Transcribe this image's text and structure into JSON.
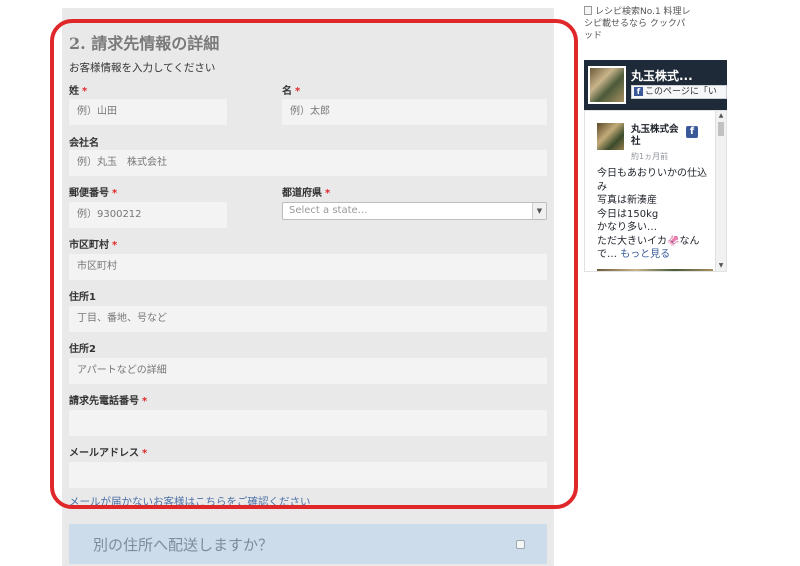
{
  "section": {
    "title": "2. 請求先情報の詳細",
    "intro": "お客様情報を入力してください"
  },
  "fields": {
    "last_name": {
      "label": "姓",
      "placeholder": "例）山田"
    },
    "first_name": {
      "label": "名",
      "placeholder": "例）太郎"
    },
    "company": {
      "label": "会社名",
      "placeholder": "例）丸玉　株式会社"
    },
    "postcode": {
      "label": "郵便番号",
      "placeholder": "例）9300212"
    },
    "state": {
      "label": "都道府県",
      "placeholder": "Select a state…"
    },
    "city": {
      "label": "市区町村",
      "placeholder": "市区町村"
    },
    "address1": {
      "label": "住所1",
      "placeholder": "丁目、番地、号など"
    },
    "address2": {
      "label": "住所2",
      "placeholder": "アパートなどの詳細"
    },
    "phone": {
      "label": "請求先電話番号",
      "placeholder": ""
    },
    "email": {
      "label": "メールアドレス",
      "placeholder": ""
    }
  },
  "required_mark": "*",
  "help_link": "メールが届かないお客様はこちらをご確認ください",
  "ship_different": {
    "label": "別の住所へ配送しますか？",
    "checked": false
  },
  "sidebar": {
    "banner_alt": "レシピ検索No.1 料理レシピ載せるなら クックパッド",
    "facebook": {
      "page_name": "丸玉株式...",
      "like_text": "このページに「い",
      "f_glyph": "f",
      "post": {
        "author": "丸玉株式会社",
        "time": "約1ヵ月前",
        "lines": [
          "今日もあおりいかの仕込み",
          "写真は新湊産",
          "今日は150kg",
          "かなり多い…",
          "ただ大きいイカ🦑なんで…"
        ],
        "more": "もっと見る"
      }
    }
  },
  "colors": {
    "highlight": "#e0282a",
    "required": "#e0282a",
    "panel": "#e9e9e9",
    "link": "#4a6fa5",
    "facebook": "#3b5998"
  }
}
